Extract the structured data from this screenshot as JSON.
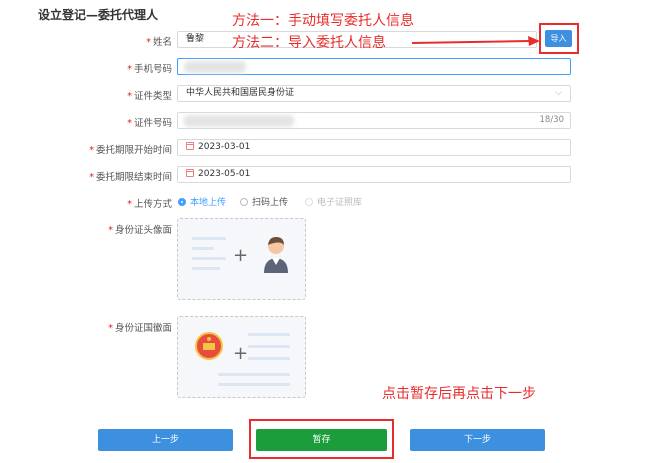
{
  "section_title": "设立登记—委托代理人",
  "annotations": {
    "method1": "方法一：手动填写委托人信息",
    "method2": "方法二：导入委托人信息",
    "save_hint": "点击暂存后再点击下一步"
  },
  "form": {
    "name": {
      "label": "姓名",
      "value": "鲁黎"
    },
    "import_button": "导入",
    "phone": {
      "label": "手机号码",
      "value": ""
    },
    "id_type": {
      "label": "证件类型",
      "value": "中华人民共和国居民身份证"
    },
    "id_number": {
      "label": "证件号码",
      "value": "",
      "counter": "18/30"
    },
    "start_date": {
      "label": "委托期限开始时间",
      "value": "2023-03-01"
    },
    "end_date": {
      "label": "委托期限结束时间",
      "value": "2023-05-01"
    },
    "upload_method": {
      "label": "上传方式",
      "options": [
        "本地上传",
        "扫码上传",
        "电子证照库"
      ],
      "selected": "本地上传"
    },
    "id_front": {
      "label": "身份证头像面"
    },
    "id_back": {
      "label": "身份证国徽面"
    }
  },
  "buttons": {
    "prev": "上一步",
    "save": "暂存",
    "next": "下一步"
  },
  "colors": {
    "primary": "#3d8fe0",
    "save": "#1a9d3a",
    "annotation": "#e82c2c",
    "required": "#e02020"
  }
}
